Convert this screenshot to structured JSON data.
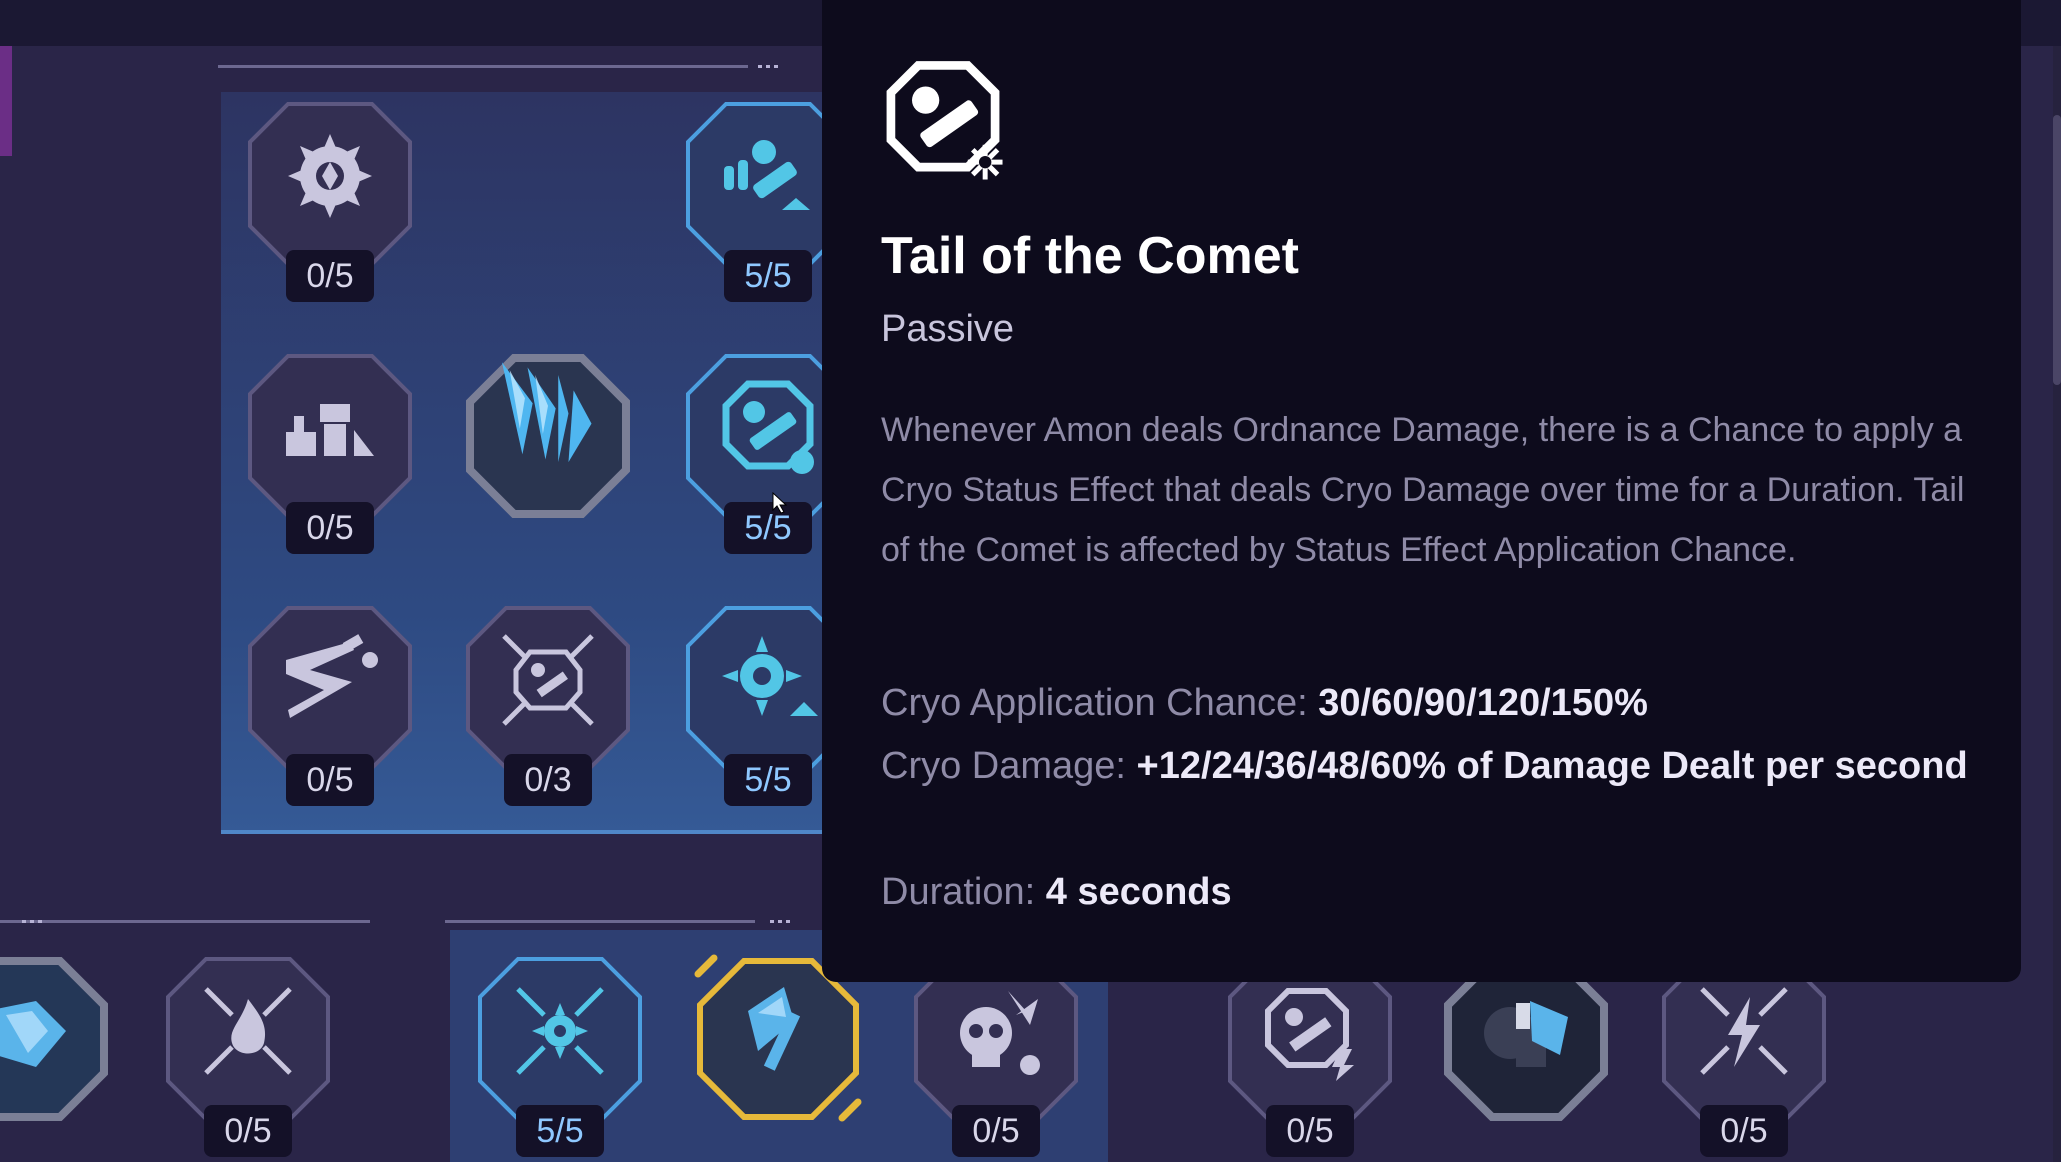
{
  "tooltip": {
    "icon": "grenade-launcher-snowflake-icon",
    "title": "Tail of the Comet",
    "type": "Passive",
    "description": "Whenever Amon deals Ordnance Damage, there is a Chance to apply a Cryo Status Effect that deals Cryo Damage over time for a Duration. Tail of the Comet is affected by Status Effect Application Chance.",
    "stats": [
      {
        "label": "Cryo Application Chance:",
        "value": "30/60/90/120/150%"
      },
      {
        "label": "Cryo Damage:",
        "value": "+12/24/36/48/60% of Damage Dealt per second"
      },
      {
        "label": "Duration:",
        "value": "4 seconds"
      }
    ]
  },
  "colors": {
    "accent": "#4db8e8",
    "gold": "#e6b93a",
    "maxed": "#8fc8ff",
    "panel": "#0d0b1c"
  },
  "nodes": [
    {
      "id": "snowflake-burst",
      "icon": "snowflake-burst-icon",
      "counter": "0/5"
    },
    {
      "id": "launcher-upgrade",
      "icon": "launcher-upgrade-icon",
      "counter": "5/5"
    },
    {
      "id": "ammo-supply",
      "icon": "ammo-supply-icon",
      "counter": "0/5"
    },
    {
      "id": "ice-crystal",
      "icon": "ice-crystal-icon",
      "counter": ""
    },
    {
      "id": "tail-of-the-comet",
      "icon": "grenade-launcher-snowflake-icon",
      "counter": "5/5"
    },
    {
      "id": "dash",
      "icon": "dash-icon",
      "counter": "0/5"
    },
    {
      "id": "crossed-launcher",
      "icon": "crossed-launcher-icon",
      "counter": "0/3"
    },
    {
      "id": "frost-star",
      "icon": "frost-star-icon",
      "counter": "5/5"
    },
    {
      "id": "ice-shield",
      "icon": "ice-shield-icon",
      "counter": ""
    },
    {
      "id": "fire",
      "icon": "fire-icon",
      "counter": "0/5"
    },
    {
      "id": "crossed-snowflake",
      "icon": "crossed-snowflake-icon",
      "counter": "5/5"
    },
    {
      "id": "ice-axe",
      "icon": "ice-axe-icon",
      "counter": ""
    },
    {
      "id": "skull-frost",
      "icon": "skull-frost-icon",
      "counter": "0/5"
    },
    {
      "id": "launcher-lightning",
      "icon": "launcher-lightning-icon",
      "counter": "0/5"
    },
    {
      "id": "cryo-gauntlet",
      "icon": "cryo-gauntlet-icon",
      "counter": ""
    },
    {
      "id": "crossed-lightning",
      "icon": "crossed-lightning-icon",
      "counter": "0/5"
    }
  ]
}
